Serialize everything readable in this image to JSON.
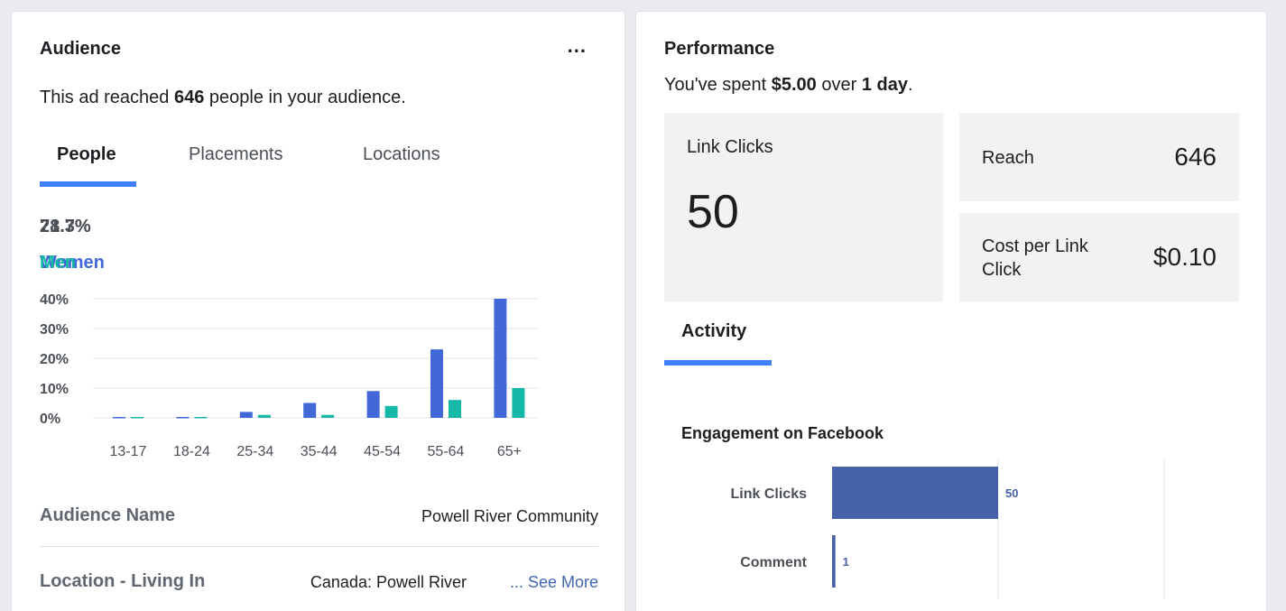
{
  "audience": {
    "title": "Audience",
    "more_label": "...",
    "summary_pre": "This ad reached ",
    "summary_reach": "646",
    "summary_post": " people in your audience.",
    "tabs": [
      {
        "label": "People",
        "active": true
      },
      {
        "label": "Placements",
        "active": false
      },
      {
        "label": "Locations",
        "active": false
      }
    ],
    "women_pct": "78.3%",
    "men_pct": "21.7%",
    "women_label": "Women",
    "men_label": "Men",
    "colors": {
      "women": "#4267d6",
      "men": "#14b8a6",
      "tab_active": "#4080ff",
      "link": "#4267b2"
    },
    "info": [
      {
        "label": "Audience Name",
        "value": "Powell River Community"
      },
      {
        "label": "Location - Living In",
        "value": "Canada: Powell River",
        "more": "... See More"
      }
    ]
  },
  "chart_data": [
    {
      "type": "bar",
      "categories": [
        "13-17",
        "18-24",
        "25-34",
        "35-44",
        "45-54",
        "55-64",
        "65+"
      ],
      "series": [
        {
          "name": "Women",
          "values": [
            0.3,
            0.3,
            2,
            5,
            9,
            23,
            40
          ]
        },
        {
          "name": "Men",
          "values": [
            0.3,
            0.3,
            1,
            1,
            4,
            6,
            10
          ]
        }
      ],
      "yticks": [
        "40%",
        "30%",
        "20%",
        "10%",
        "0%"
      ],
      "ylim": [
        0,
        40
      ],
      "grid": true
    },
    {
      "type": "bar",
      "orientation": "horizontal",
      "title": "Engagement on Facebook",
      "categories": [
        "Link Clicks",
        "Comment"
      ],
      "values": [
        50,
        1
      ],
      "value_labels": [
        "50",
        "1"
      ],
      "color": "#4662a8"
    }
  ],
  "performance": {
    "title": "Performance",
    "summary_pre": "You've spent ",
    "summary_amount": "$5.00",
    "summary_mid": " over ",
    "summary_period": "1 day",
    "summary_post": ".",
    "link_clicks_label": "Link Clicks",
    "link_clicks_value": "50",
    "reach_label": "Reach",
    "reach_value": "646",
    "cpc_label": "Cost per Link Click",
    "cpc_value": "$0.10",
    "activity_tab": "Activity",
    "engagement_title": "Engagement on Facebook"
  }
}
